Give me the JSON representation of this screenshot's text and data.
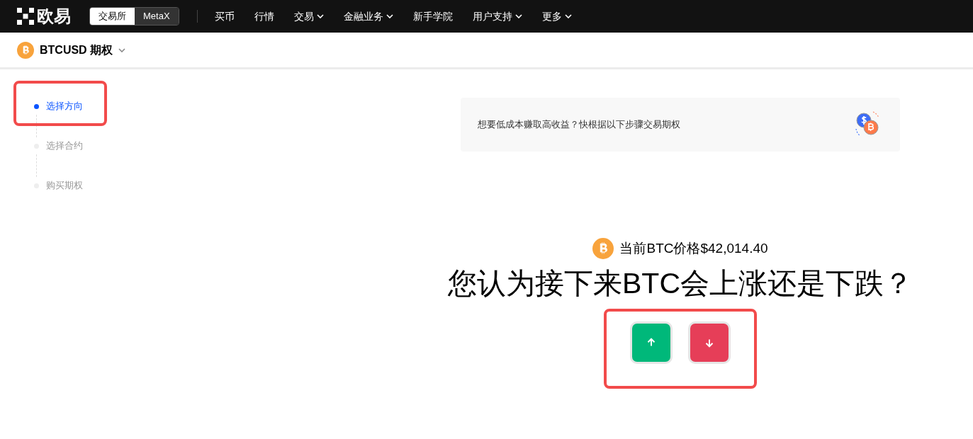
{
  "nav": {
    "logo": "欧易",
    "switch": [
      {
        "label": "交易所",
        "selected": true
      },
      {
        "label": "MetaX",
        "selected": false
      }
    ],
    "menu": [
      {
        "label": "买币",
        "dropdown": false
      },
      {
        "label": "行情",
        "dropdown": false
      },
      {
        "label": "交易",
        "dropdown": true
      },
      {
        "label": "金融业务",
        "dropdown": true
      },
      {
        "label": "新手学院",
        "dropdown": false
      },
      {
        "label": "用户支持",
        "dropdown": true
      },
      {
        "label": "更多",
        "dropdown": true
      }
    ]
  },
  "instrument": {
    "title": "BTCUSD 期权"
  },
  "steps": [
    {
      "label": "选择方向",
      "selected": true,
      "highlighted": true
    },
    {
      "label": "选择合约",
      "selected": false,
      "highlighted": false
    },
    {
      "label": "购买期权",
      "selected": false,
      "highlighted": false
    }
  ],
  "banner": {
    "text": "想要低成本赚取高收益？快根据以下步骤交易期权"
  },
  "price": "当前BTC价格$42,014.40",
  "question": "您认为接下来BTC会上涨还是下跌？",
  "directions": {
    "highlighted": true,
    "buttons": [
      {
        "kind": "up"
      },
      {
        "kind": "down"
      }
    ]
  }
}
